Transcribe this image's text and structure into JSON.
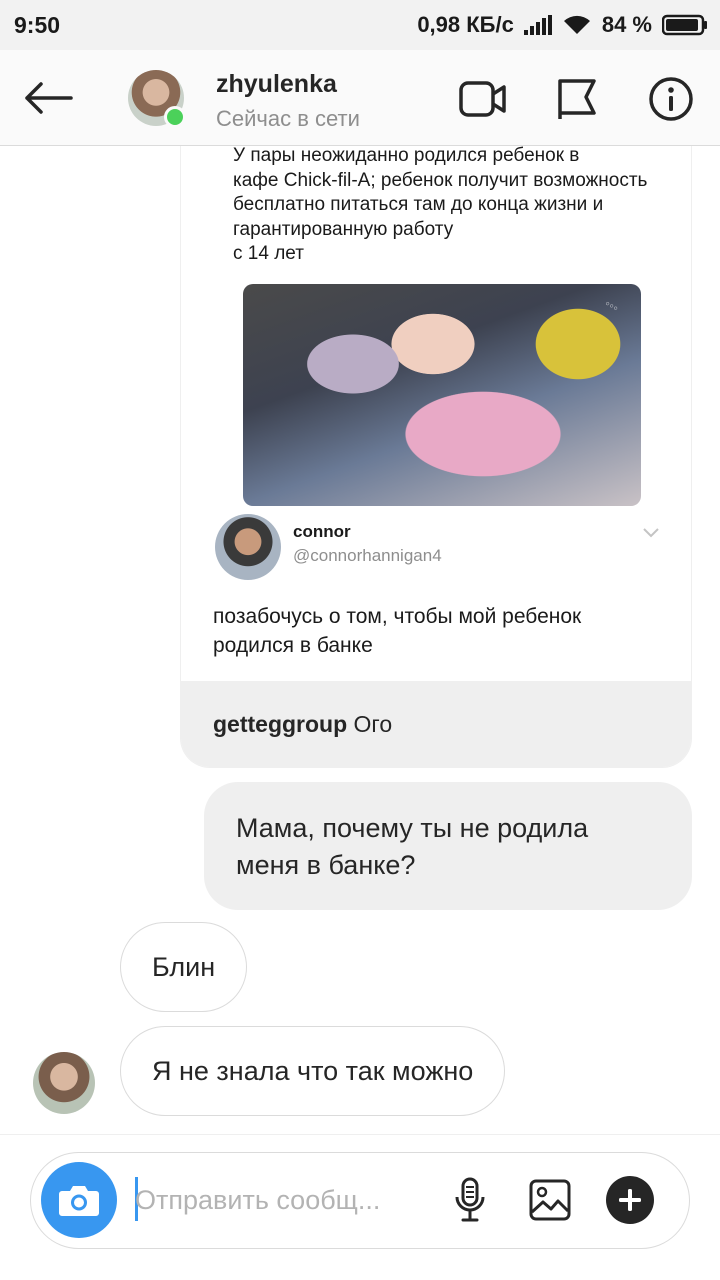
{
  "status_bar": {
    "time": "9:50",
    "speed": "0,98 КБ/с",
    "battery": "84 %"
  },
  "header": {
    "username": "zhyulenka",
    "status": "Сейчас в сети",
    "icons": [
      "back-arrow-icon",
      "video-call-icon",
      "flag-icon",
      "info-icon"
    ]
  },
  "shared_post": {
    "headline": "У пары неожиданно родился ребенок в\nкафе Chick-fil-A; ребенок получит возможность\nбесплатно питаться там до конца жизни и\nгарантированную работу\nс 14 лет",
    "tweet_name": "connor",
    "tweet_handle": "@connorhannigan4",
    "tweet_text": "позабочусь о том, чтобы мой ребенок\nродился в банке",
    "caption_user": "getteggroup",
    "caption_text": "Ого"
  },
  "messages": [
    {
      "direction": "outgoing",
      "text": "Мама, почему ты не родила\nменя в банке?"
    },
    {
      "direction": "incoming",
      "text": "Блин"
    },
    {
      "direction": "incoming",
      "text": "Я не знала что так можно"
    }
  ],
  "composer": {
    "placeholder": "Отправить сообщ..."
  },
  "colors": {
    "accent": "#3897f0",
    "online": "#4bd15a",
    "bubble": "#efefef"
  }
}
